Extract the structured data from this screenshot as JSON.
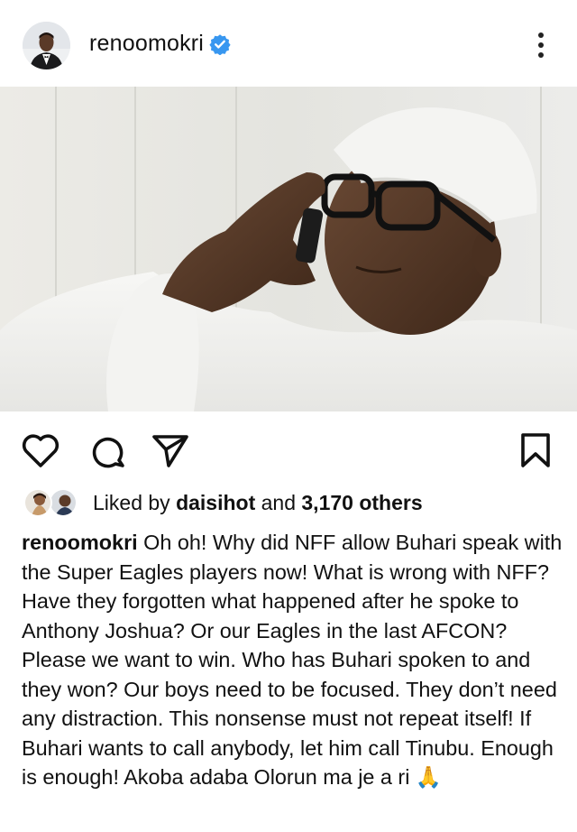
{
  "post": {
    "username": "renoomokri",
    "verified": true,
    "menu_icon": "more-vertical-icon",
    "image_alt": "Man in white cap and glasses talking on phone",
    "actions": {
      "like_icon": "heart-icon",
      "comment_icon": "comment-icon",
      "share_icon": "send-icon",
      "save_icon": "bookmark-icon"
    },
    "likes": {
      "prefix": "Liked by",
      "user": "daisihot",
      "and": "and",
      "others": "3,170 others"
    },
    "caption": {
      "username": "renoomokri",
      "text": "Oh oh! Why did NFF allow Buhari speak with the Super Eagles players now! What is wrong with NFF? Have they forgotten what happened after he spoke to Anthony Joshua? Or our Eagles in the last AFCON? Please we want to win. Who has Buhari spoken to and they won? Our boys need to be focused. They don’t need any distraction. This nonsense must not repeat itself! If Buhari wants to call anybody, let him call Tinubu. Enough is enough! Akoba adaba Olorun ma je a ri",
      "emoji": "🙏"
    }
  },
  "colors": {
    "verified_blue": "#3897f0",
    "text": "#111111",
    "background": "#ffffff"
  }
}
